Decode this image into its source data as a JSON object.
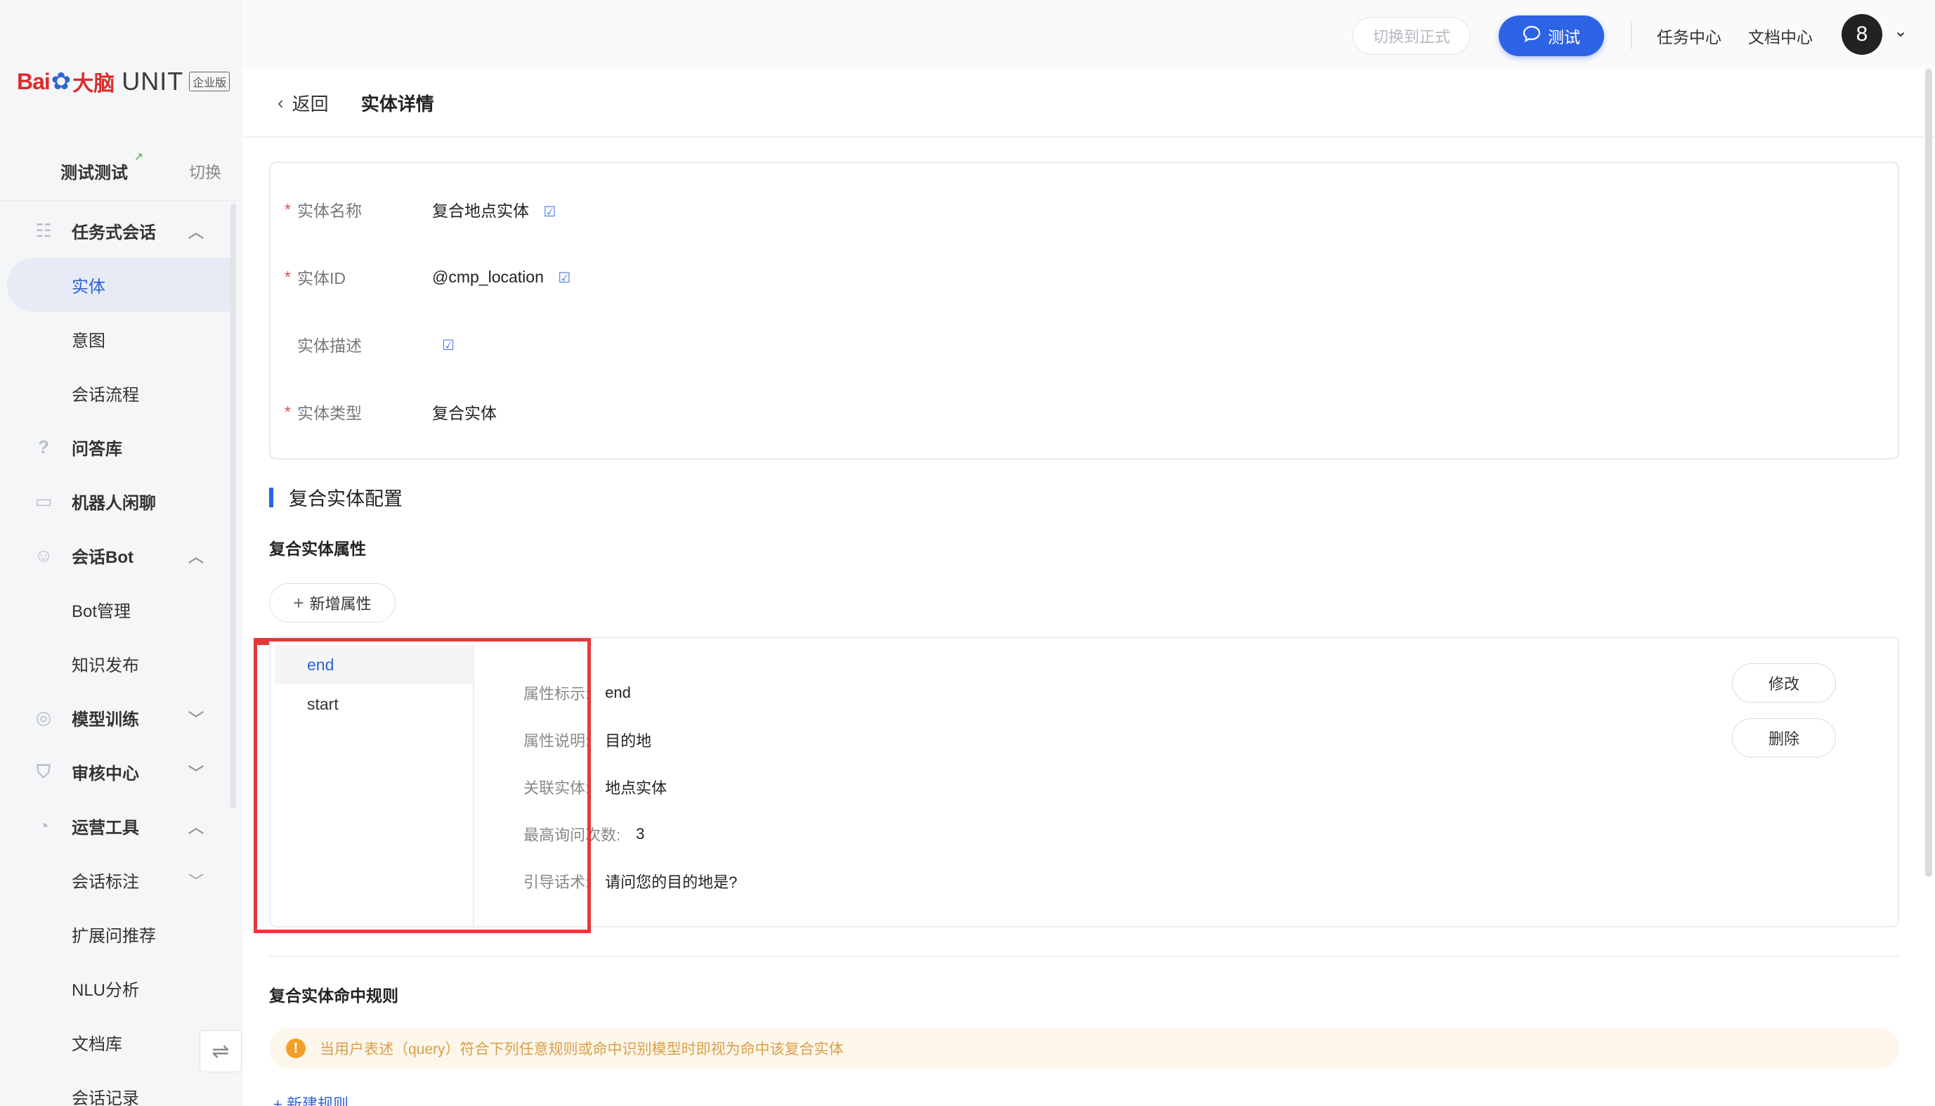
{
  "brand": {
    "bai": "Bai",
    "paw": "✿",
    "danao": "大脑",
    "unit": "UNIT",
    "edition": "企业版"
  },
  "project": {
    "name": "测试测试",
    "switch_label": "切换"
  },
  "sidebar": {
    "items": [
      {
        "label": "任务式会话",
        "type": "group",
        "icon": "tree-icon",
        "chevron": "^"
      },
      {
        "label": "实体",
        "type": "sub",
        "active": true
      },
      {
        "label": "意图",
        "type": "sub"
      },
      {
        "label": "会话流程",
        "type": "sub"
      },
      {
        "label": "问答库",
        "type": "group",
        "icon": "question-icon"
      },
      {
        "label": "机器人闲聊",
        "type": "group",
        "icon": "chat-bubble-icon"
      },
      {
        "label": "会话Bot",
        "type": "group",
        "icon": "bot-icon",
        "chevron": "^"
      },
      {
        "label": "Bot管理",
        "type": "sub"
      },
      {
        "label": "知识发布",
        "type": "sub"
      },
      {
        "label": "模型训练",
        "type": "group",
        "icon": "model-icon",
        "chevron": "v"
      },
      {
        "label": "审核中心",
        "type": "group",
        "icon": "shield-icon",
        "chevron": "v"
      },
      {
        "label": "运营工具",
        "type": "group",
        "icon": "clock-icon",
        "chevron": "^"
      },
      {
        "label": "会话标注",
        "type": "sub",
        "chevron": "v"
      },
      {
        "label": "扩展问推荐",
        "type": "sub"
      },
      {
        "label": "NLU分析",
        "type": "sub"
      },
      {
        "label": "文档库",
        "type": "sub"
      },
      {
        "label": "会话记录",
        "type": "sub"
      }
    ]
  },
  "topbar": {
    "switch_formal": "切换到正式",
    "test_label": "测试",
    "task_center": "任务中心",
    "doc_center": "文档中心",
    "avatar_text": "8"
  },
  "header": {
    "back_label": "返回",
    "title": "实体详情"
  },
  "entity": {
    "name_label": "实体名称",
    "name_value": "复合地点实体",
    "id_label": "实体ID",
    "id_value": "@cmp_location",
    "desc_label": "实体描述",
    "desc_value": "",
    "type_label": "实体类型",
    "type_value": "复合实体"
  },
  "composite": {
    "section_title": "复合实体配置",
    "attr_title": "复合实体属性",
    "add_attr_label": "新增属性",
    "attributes": [
      "end",
      "start"
    ],
    "detail": {
      "tag_label": "属性标示:",
      "tag_value": "end",
      "desc_label": "属性说明:",
      "desc_value": "目的地",
      "entity_label": "关联实体:",
      "entity_value": "地点实体",
      "max_label": "最高询问次数:",
      "max_value": "3",
      "prompt_label": "引导话术:",
      "prompt_value": "请问您的目的地是?"
    },
    "edit_label": "修改",
    "delete_label": "删除",
    "rule_title": "复合实体命中规则",
    "notice": "当用户表述（query）符合下列任意规则或命中识别模型时即视为命中该复合实体",
    "new_rule": "+ 新建规则"
  },
  "colors": {
    "primary": "#2d64e6",
    "highlight": "#e23a3a",
    "warning": "#f2a02b"
  }
}
